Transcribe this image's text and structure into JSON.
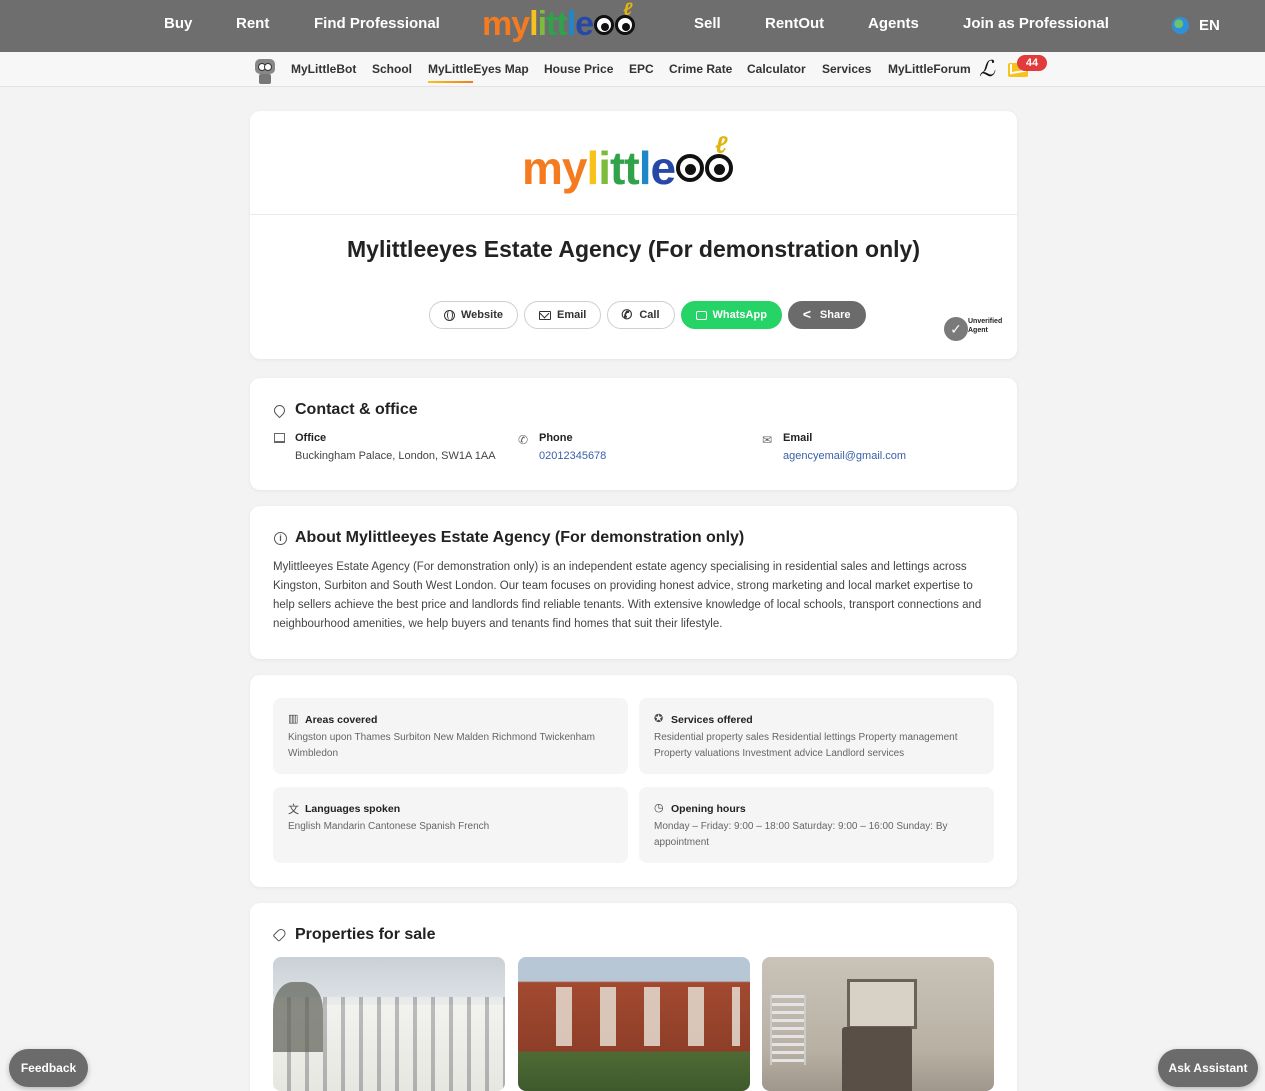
{
  "topnav": {
    "links": [
      "Buy",
      "Rent",
      "Find Professional",
      "Sell",
      "RentOut",
      "Agents",
      "Join as Professional"
    ],
    "logo_text": [
      "my",
      "l",
      "i",
      "t",
      "t",
      "l",
      "e"
    ],
    "language": "EN"
  },
  "subnav": {
    "links": [
      "MyLittleBot",
      "School",
      "MyLittleEyes Map",
      "House Price",
      "EPC",
      "Crime Rate",
      "Calculator",
      "Services",
      "MyLittleForum"
    ],
    "active": "MyLittleEyes Map",
    "message_count": "44"
  },
  "hero": {
    "logo_text": [
      "my",
      "l",
      "i",
      "t",
      "t",
      "l",
      "e"
    ],
    "title": "Mylittleeyes Estate Agency (For demonstration only)",
    "buttons": {
      "website": "Website",
      "email": "Email",
      "call": "Call",
      "whatsapp": "WhatsApp",
      "share": "Share"
    },
    "verification": "Unverified Agent"
  },
  "contact": {
    "title": "Contact & office",
    "office_label": "Office",
    "office_value": "Buckingham Palace, London, SW1A 1AA",
    "phone_label": "Phone",
    "phone_value": "02012345678",
    "email_label": "Email",
    "email_value": "agencyemail@gmail.com"
  },
  "about": {
    "title": "About Mylittleeyes Estate Agency (For demonstration only)",
    "text": "Mylittleeyes Estate Agency (For demonstration only) is an independent estate agency specialising in residential sales and lettings across Kingston, Surbiton and South West London. Our team focuses on providing honest advice, strong marketing and local market expertise to help sellers achieve the best price and landlords find reliable tenants. With extensive knowledge of local schools, transport connections and neighbourhood amenities, we help buyers and tenants find homes that suit their lifestyle."
  },
  "details": {
    "areas_label": "Areas covered",
    "areas_value": "Kingston upon Thames Surbiton New Malden Richmond Twickenham Wimbledon",
    "services_label": "Services offered",
    "services_value": "Residential property sales Residential lettings Property management Property valuations Investment advice Landlord services",
    "languages_label": "Languages spoken",
    "languages_value": "English Mandarin Cantonese Spanish French",
    "hours_label": "Opening hours",
    "hours_value": "Monday – Friday: 9:00 – 18:00 Saturday: 9:00 – 16:00 Sunday: By appointment"
  },
  "properties": {
    "title": "Properties for sale"
  },
  "floating": {
    "feedback": "Feedback",
    "assistant": "Ask Assistant"
  },
  "colors": {
    "topnav_bg": "#6e6e6e",
    "whatsapp": "#25d366",
    "badge": "#e23b3b",
    "link": "#3a5fa8"
  }
}
